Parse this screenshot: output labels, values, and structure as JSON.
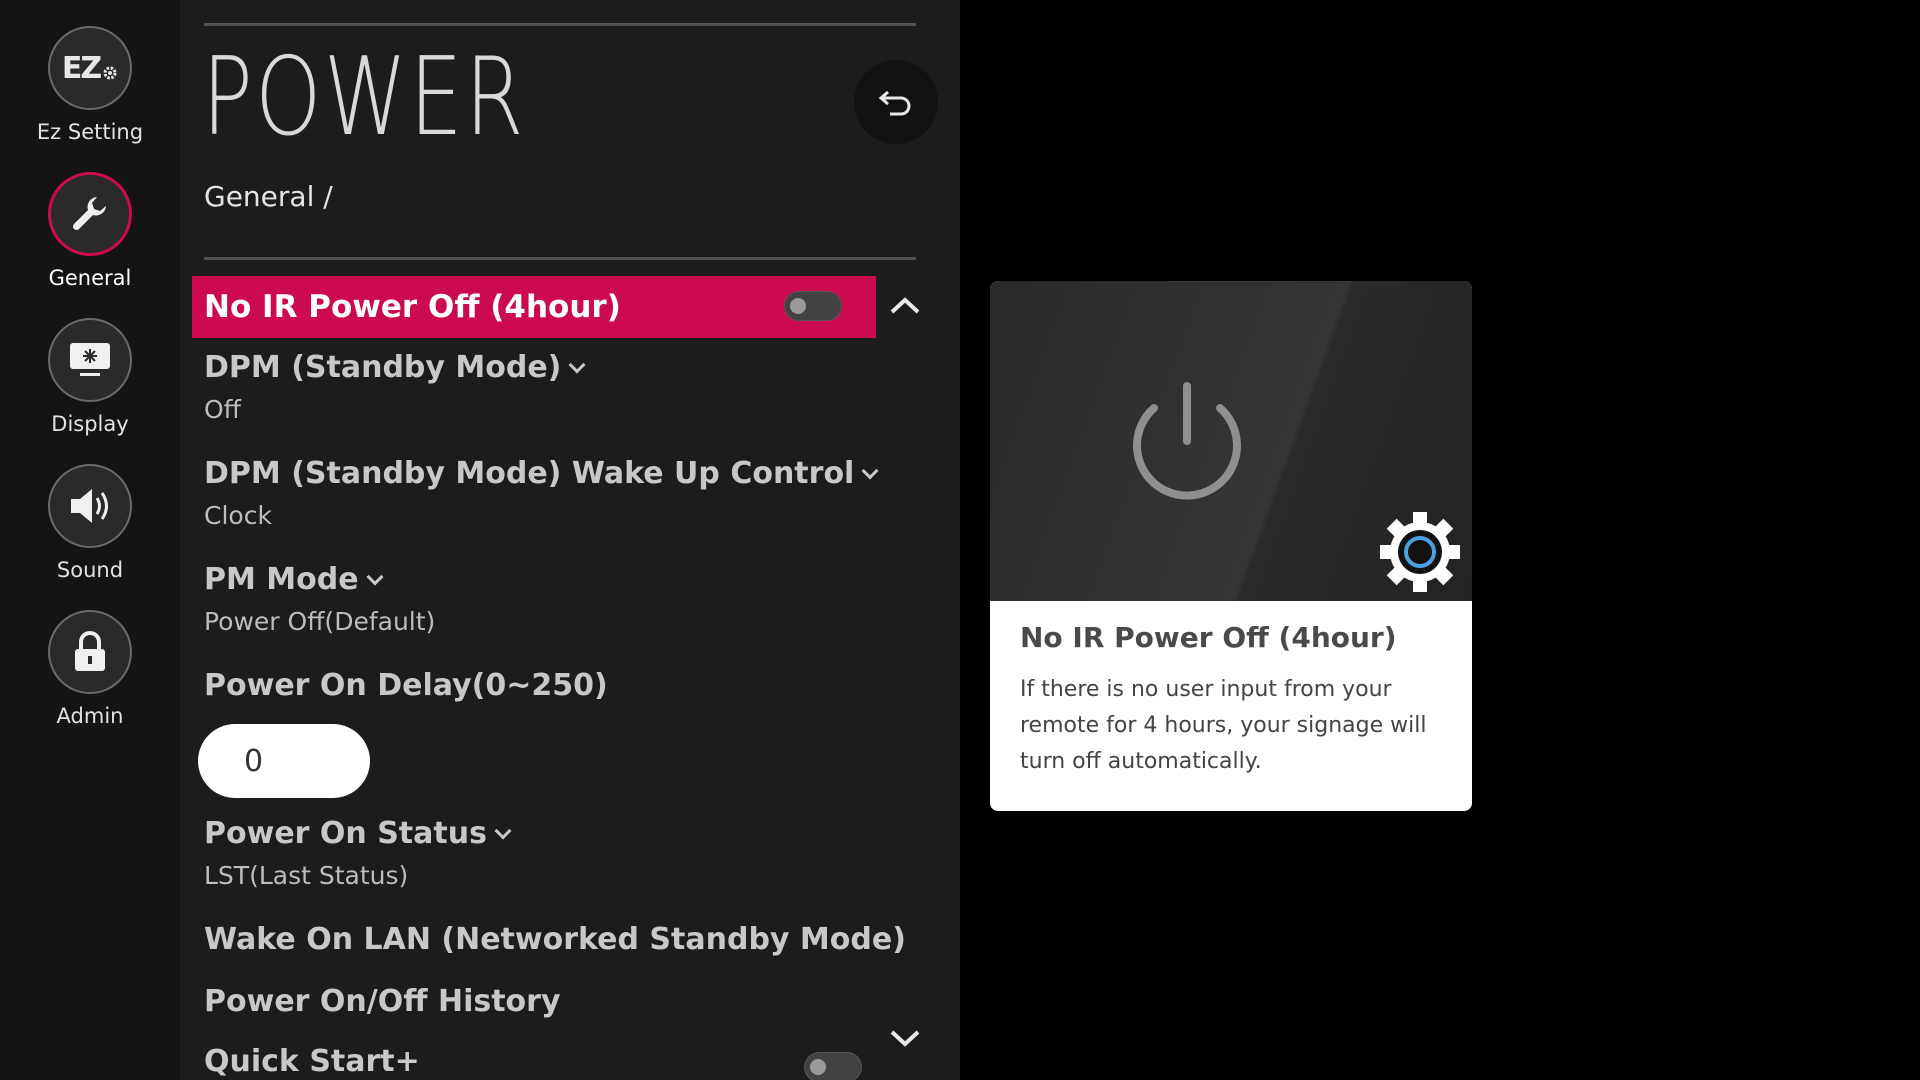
{
  "sidebar": {
    "items": [
      {
        "label": "Ez Setting",
        "icon": "ez-setting-icon"
      },
      {
        "label": "General",
        "icon": "wrench-icon",
        "active": true
      },
      {
        "label": "Display",
        "icon": "display-icon"
      },
      {
        "label": "Sound",
        "icon": "speaker-icon"
      },
      {
        "label": "Admin",
        "icon": "lock-icon"
      }
    ],
    "ez_glyph": "EZ"
  },
  "header": {
    "title": "POWER",
    "breadcrumb": "General /"
  },
  "settings": {
    "selected": {
      "label": "No IR Power Off (4hour)",
      "toggle_on": false
    },
    "dpm": {
      "label": "DPM (Standby Mode)",
      "value": "Off"
    },
    "dpm_wake": {
      "label": "DPM (Standby Mode) Wake Up Control",
      "value": "Clock"
    },
    "pm_mode": {
      "label": "PM Mode",
      "value": "Power Off(Default)"
    },
    "power_on_delay": {
      "label": "Power On Delay(0~250)",
      "value": "0"
    },
    "power_on_status": {
      "label": "Power On Status",
      "value": "LST(Last Status)"
    },
    "wake_on_lan": {
      "label": "Wake On LAN (Networked Standby Mode)"
    },
    "history": {
      "label": "Power On/Off History"
    },
    "quick_start": {
      "label": "Quick Start+",
      "toggle_on": false
    }
  },
  "help_card": {
    "title": "No IR Power Off (4hour)",
    "description": "If there is no user input from your remote for 4 hours, your signage will turn off automatically."
  },
  "colors": {
    "accent": "#cc0a4f",
    "panel_bg": "#1c1c1c",
    "rail_bg": "#141414"
  }
}
